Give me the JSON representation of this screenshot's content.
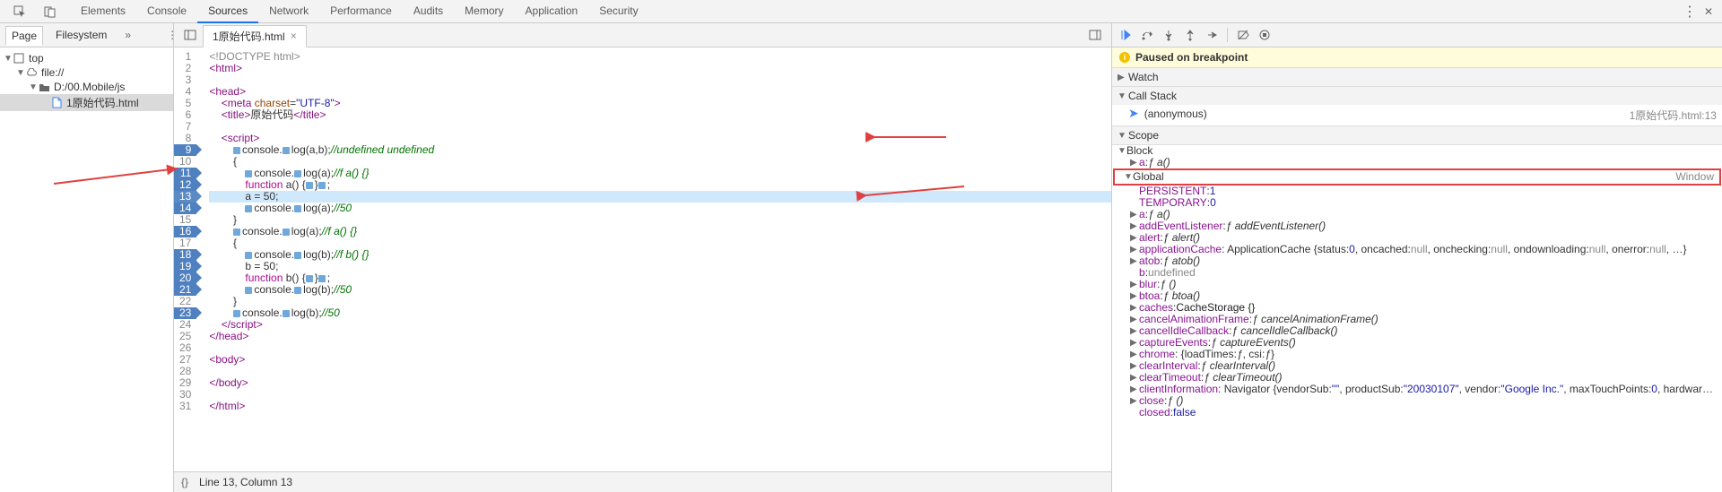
{
  "tabs": [
    "Elements",
    "Console",
    "Sources",
    "Network",
    "Performance",
    "Audits",
    "Memory",
    "Application",
    "Security"
  ],
  "activeTab": 2,
  "leftTabs": {
    "page": "Page",
    "fs": "Filesystem"
  },
  "tree": [
    {
      "depth": 0,
      "label": "top",
      "icon": "frame",
      "exp": true
    },
    {
      "depth": 1,
      "label": "file://",
      "icon": "cloud",
      "exp": true
    },
    {
      "depth": 2,
      "label": "D:/00.Mobile/js",
      "icon": "folder",
      "exp": true
    },
    {
      "depth": 3,
      "label": "1原始代码.html",
      "icon": "file",
      "sel": true
    }
  ],
  "openFile": "1原始代码.html",
  "code": [
    {
      "n": 1,
      "html": "<span class='c-obj'>&lt;!DOCTYPE html&gt;</span>"
    },
    {
      "n": 2,
      "html": "<span class='c-tag'>&lt;html&gt;</span>"
    },
    {
      "n": 3,
      "html": ""
    },
    {
      "n": 4,
      "html": "<span class='c-tag'>&lt;head&gt;</span>"
    },
    {
      "n": 5,
      "html": "    <span class='c-tag'>&lt;meta</span> <span class='c-attr'>charset</span>=<span class='c-str'>\"UTF-8\"</span><span class='c-tag'>&gt;</span>"
    },
    {
      "n": 6,
      "html": "    <span class='c-tag'>&lt;title&gt;</span>原始代码<span class='c-tag'>&lt;/title&gt;</span>"
    },
    {
      "n": 7,
      "html": ""
    },
    {
      "n": 8,
      "html": "    <span class='c-tag'>&lt;script&gt;</span>"
    },
    {
      "n": 9,
      "exec": true,
      "html": "        <span class='dot'></span>console.<span class='dot'></span>log(a,b);<span class='c-cm'>//undefined undefined</span>"
    },
    {
      "n": 10,
      "html": "        {"
    },
    {
      "n": 11,
      "exec": true,
      "html": "            <span class='dot'></span>console.<span class='dot'></span>log(a);<span class='c-cm'>//f a() {}</span>"
    },
    {
      "n": 12,
      "exec": true,
      "html": "            <span class='c-kw'>function</span> a() {<span class='dot'></span>}<span class='dot'></span>;"
    },
    {
      "n": 13,
      "cur": true,
      "hl": true,
      "html": "            a = 50;"
    },
    {
      "n": 14,
      "exec": true,
      "html": "            <span class='dot'></span>console.<span class='dot'></span>log(a);<span class='c-cm'>//50</span>"
    },
    {
      "n": 15,
      "html": "        }"
    },
    {
      "n": 16,
      "exec": true,
      "html": "        <span class='dot'></span>console.<span class='dot'></span>log(a);<span class='c-cm'>//f a() {}</span>"
    },
    {
      "n": 17,
      "html": "        {"
    },
    {
      "n": 18,
      "exec": true,
      "html": "            <span class='dot'></span>console.<span class='dot'></span>log(b);<span class='c-cm'>//f b() {}</span>"
    },
    {
      "n": 19,
      "exec": true,
      "html": "            b = 50;"
    },
    {
      "n": 20,
      "exec": true,
      "html": "            <span class='c-kw'>function</span> b() {<span class='dot'></span>}<span class='dot'></span>;"
    },
    {
      "n": 21,
      "exec": true,
      "html": "            <span class='dot'></span>console.<span class='dot'></span>log(b);<span class='c-cm'>//50</span>"
    },
    {
      "n": 22,
      "html": "        }"
    },
    {
      "n": 23,
      "exec": true,
      "html": "        <span class='dot'></span>console.<span class='dot'></span>log(b);<span class='c-cm'>//50</span>"
    },
    {
      "n": 24,
      "html": "    <span class='c-tag'>&lt;/script&gt;</span>"
    },
    {
      "n": 25,
      "html": "<span class='c-tag'>&lt;/head&gt;</span>"
    },
    {
      "n": 26,
      "html": ""
    },
    {
      "n": 27,
      "html": "<span class='c-tag'>&lt;body&gt;</span>"
    },
    {
      "n": 28,
      "html": ""
    },
    {
      "n": 29,
      "html": "<span class='c-tag'>&lt;/body&gt;</span>"
    },
    {
      "n": 30,
      "html": ""
    },
    {
      "n": 31,
      "html": "<span class='c-tag'>&lt;/html&gt;</span>"
    }
  ],
  "status": "Line 13, Column 13",
  "paused": "Paused on breakpoint",
  "watch": "Watch",
  "callstack": "Call Stack",
  "call": {
    "name": "(anonymous)",
    "loc": "1原始代码.html:13"
  },
  "scope": "Scope",
  "block": "Block",
  "blockItems": [
    {
      "k": "a",
      "v": "ƒ a()"
    }
  ],
  "global": "Global",
  "globalType": "Window",
  "globals": [
    {
      "k": "PERSISTENT",
      "v": "1",
      "num": true,
      "exp": false
    },
    {
      "k": "TEMPORARY",
      "v": "0",
      "num": true,
      "exp": false
    },
    {
      "k": "a",
      "v": "ƒ a()",
      "it": true,
      "exp": true
    },
    {
      "k": "addEventListener",
      "v": "ƒ addEventListener()",
      "it": true,
      "exp": true
    },
    {
      "k": "alert",
      "v": "ƒ alert()",
      "it": true,
      "exp": true
    },
    {
      "k": "applicationCache",
      "raw": "ApplicationCache {status: <span class='pval'>0</span>, oncached: <span class='pgray'>null</span>, onchecking: <span class='pgray'>null</span>, ondownloading: <span class='pgray'>null</span>, onerror: <span class='pgray'>null</span>, …}",
      "exp": true
    },
    {
      "k": "atob",
      "v": "ƒ atob()",
      "it": true,
      "exp": true
    },
    {
      "k": "b",
      "v": "undefined",
      "gray": true,
      "exp": false
    },
    {
      "k": "blur",
      "v": "ƒ ()",
      "it": true,
      "exp": true
    },
    {
      "k": "btoa",
      "v": "ƒ btoa()",
      "it": true,
      "exp": true
    },
    {
      "k": "caches",
      "v": "CacheStorage {}",
      "exp": true
    },
    {
      "k": "cancelAnimationFrame",
      "v": "ƒ cancelAnimationFrame()",
      "it": true,
      "exp": true
    },
    {
      "k": "cancelIdleCallback",
      "v": "ƒ cancelIdleCallback()",
      "it": true,
      "exp": true
    },
    {
      "k": "captureEvents",
      "v": "ƒ captureEvents()",
      "it": true,
      "exp": true
    },
    {
      "k": "chrome",
      "raw": "{loadTimes: <span class='pit'>ƒ</span>, csi: <span class='pit'>ƒ</span>}",
      "exp": true
    },
    {
      "k": "clearInterval",
      "v": "ƒ clearInterval()",
      "it": true,
      "exp": true
    },
    {
      "k": "clearTimeout",
      "v": "ƒ clearTimeout()",
      "it": true,
      "exp": true
    },
    {
      "k": "clientInformation",
      "raw": "Navigator {vendorSub: <span class='pval'>\"\"</span>, productSub: <span class='pval'>\"20030107\"</span>, vendor: <span class='pval'>\"Google Inc.\"</span>, maxTouchPoints: <span class='pval'>0</span>, hardwar…",
      "exp": true
    },
    {
      "k": "close",
      "v": "ƒ ()",
      "it": true,
      "exp": true
    },
    {
      "k": "closed",
      "v": "false",
      "exp": false,
      "val": true
    }
  ]
}
